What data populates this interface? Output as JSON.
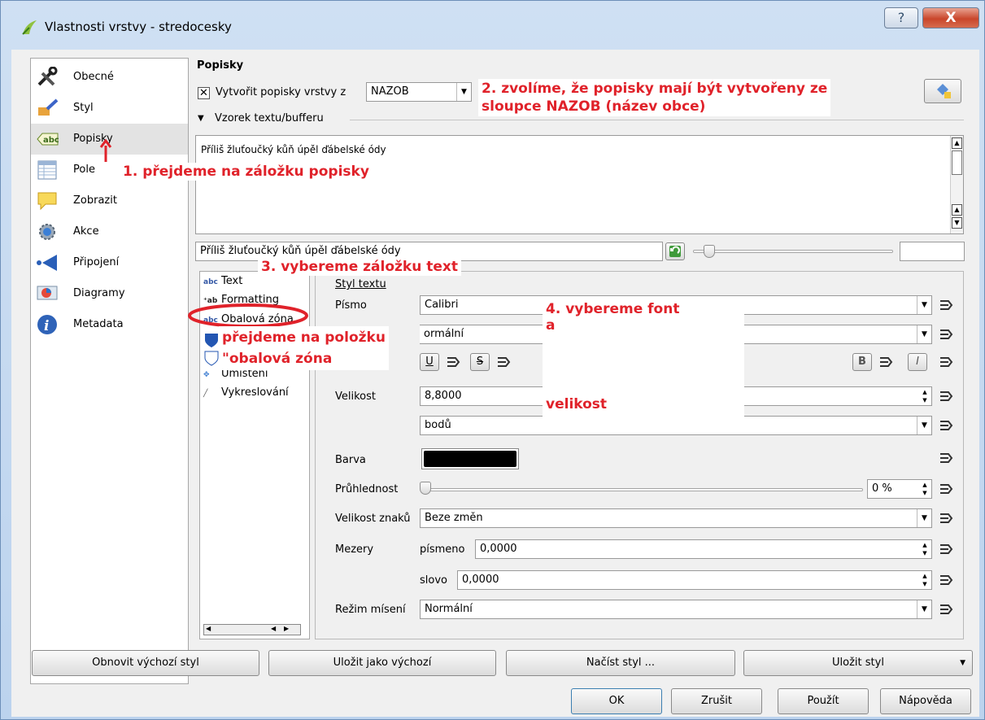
{
  "window": {
    "title": "Vlastnosti vrstvy - stredocesky",
    "help_glyph": "?",
    "close_glyph": "X"
  },
  "sidebar": {
    "items": [
      {
        "label": "Obecné",
        "icon": "tools-icon"
      },
      {
        "label": "Styl",
        "icon": "paintbrush-icon"
      },
      {
        "label": "Popisky",
        "icon": "abc-icon"
      },
      {
        "label": "Pole",
        "icon": "table-icon"
      },
      {
        "label": "Zobrazit",
        "icon": "speech-bubble-icon"
      },
      {
        "label": "Akce",
        "icon": "gear-icon"
      },
      {
        "label": "Připojení",
        "icon": "join-icon"
      },
      {
        "label": "Diagramy",
        "icon": "diagram-icon"
      },
      {
        "label": "Metadata",
        "icon": "info-icon"
      }
    ]
  },
  "labels": {
    "heading": "Popisky",
    "create_labels_checkbox": "Vytvořit popisky vrstvy z",
    "field_value": "NAZOB",
    "sample_section": "Vzorek textu/bufferu",
    "sample_text": "Příliš žluťoučký kůň úpěl ďábelské ódy",
    "sample_input": "Příliš žluťoučký kůň úpěl ďábelské ódy"
  },
  "tabs": {
    "items": [
      {
        "label": "Text",
        "icon": "abc"
      },
      {
        "label": "Formatting",
        "icon": "+ab"
      },
      {
        "label": "Obalová zóna",
        "icon": "abc"
      },
      {
        "label": "",
        "icon": "shield"
      },
      {
        "label": "",
        "icon": "shape"
      },
      {
        "label": "Umístění",
        "icon": "placement"
      },
      {
        "label": "Vykreslování",
        "icon": "brush"
      }
    ]
  },
  "text_style": {
    "section_title": "Styl textu",
    "font_label": "Písmo",
    "font_value": "Calibri",
    "style_value": "ormální",
    "size_label": "Velikost",
    "size_value": "8,8000",
    "unit_value": "bodů",
    "color_label": "Barva",
    "color_value": "#000000",
    "transparency_label": "Průhlednost",
    "transparency_value": "0 %",
    "case_label": "Velikost znaků",
    "case_value": "Beze změn",
    "spacing_label": "Mezery",
    "letter_label": "písmeno",
    "letter_value": "0,0000",
    "word_label": "slovo",
    "word_value": "0,0000",
    "blend_label": "Režim mísení",
    "blend_value": "Normální",
    "underline_glyph": "U",
    "strike_glyph": "S",
    "bold_glyph": "B",
    "italic_glyph": "I"
  },
  "annotations": {
    "a1": "1. přejdeme na záložku popisky",
    "a2_line1": "2. zvolíme, že popisky mají být vytvořeny ze",
    "a2_line2": "sloupce NAZOB (název obce)",
    "a3": "3. vybereme záložku text",
    "a4_line1": "4. vybereme font",
    "a4_line2": "a",
    "a4_line3": "velikost",
    "a5_line1": "přejdeme na položku",
    "a5_line2": "\"obalová zóna"
  },
  "footer": {
    "restore_default": "Obnovit výchozí styl",
    "save_default": "Uložit jako výchozí",
    "load_style": "Načíst styl ...",
    "save_style": "Uložit styl",
    "ok": "OK",
    "cancel": "Zrušit",
    "apply": "Použít",
    "help": "Nápověda"
  },
  "colors": {
    "annotation": "#e0222a",
    "selection": "#e3e3e3"
  }
}
